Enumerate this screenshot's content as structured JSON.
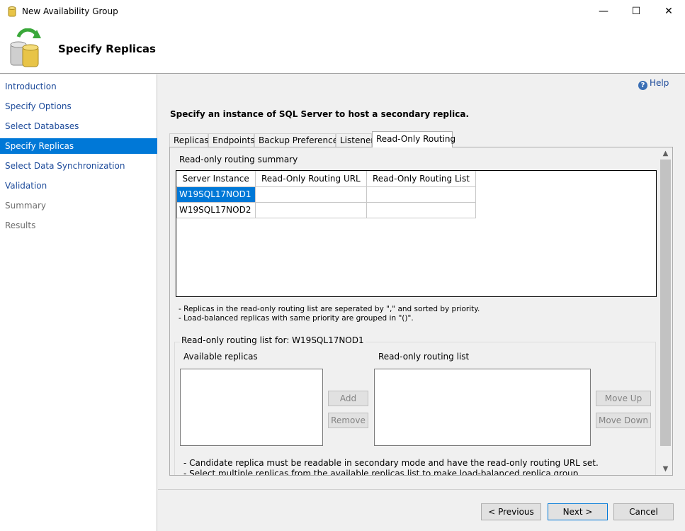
{
  "window": {
    "title": "New Availability Group",
    "minimize": "—",
    "maximize": "☐",
    "close": "✕"
  },
  "header": {
    "page_title": "Specify Replicas"
  },
  "nav": {
    "items": [
      {
        "label": "Introduction"
      },
      {
        "label": "Specify Options"
      },
      {
        "label": "Select Databases"
      },
      {
        "label": "Specify Replicas"
      },
      {
        "label": "Select Data Synchronization"
      },
      {
        "label": "Validation"
      },
      {
        "label": "Summary"
      },
      {
        "label": "Results"
      }
    ]
  },
  "main": {
    "help_label": "Help",
    "instruction": "Specify an instance of SQL Server to host a secondary replica.",
    "tabs": [
      {
        "label": "Replicas"
      },
      {
        "label": "Endpoints"
      },
      {
        "label": "Backup Preferences"
      },
      {
        "label": "Listener"
      },
      {
        "label": "Read-Only Routing"
      }
    ],
    "summary_label": "Read-only routing summary",
    "grid": {
      "columns": [
        "Server Instance",
        "Read-Only Routing URL",
        "Read-Only Routing List"
      ],
      "rows": [
        [
          "W19SQL17NOD1",
          "",
          ""
        ],
        [
          "W19SQL17NOD2",
          "",
          ""
        ]
      ]
    },
    "notes": [
      "- Replicas in the read-only routing list are seperated by \",\" and sorted by priority.",
      "- Load-balanced replicas with same priority are grouped in \"()\"."
    ],
    "routing_group_title": "Read-only routing list for: W19SQL17NOD1",
    "available_replicas_label": "Available replicas",
    "routing_list_label": "Read-only routing list",
    "add_label": "Add",
    "remove_label": "Remove",
    "move_up_label": "Move Up",
    "move_down_label": "Move Down",
    "notes2": [
      "- Candidate replica must be readable in secondary mode and have the read-only routing URL set.",
      "- Select multiple replicas from the available replicas list to make load-balanced replica group."
    ]
  },
  "footer": {
    "previous_label": "< Previous",
    "next_label": "Next >",
    "cancel_label": "Cancel"
  }
}
